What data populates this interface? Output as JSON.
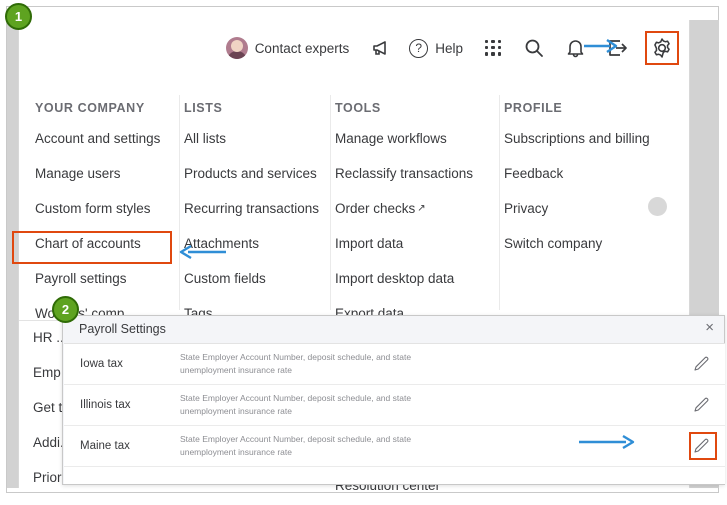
{
  "toolbar": {
    "contact_experts": "Contact experts",
    "megaphone_icon": "megaphone-icon",
    "help": "Help",
    "grid_icon": "app-grid-icon",
    "search_icon": "search-icon",
    "bell_icon": "notification-bell-icon",
    "exit_icon": "exit-icon",
    "gear_icon": "gear-icon"
  },
  "megamenu": {
    "columns": [
      {
        "header": "YOUR COMPANY",
        "items": [
          "Account and settings",
          "Manage users",
          "Custom form styles",
          "Chart of accounts",
          "Payroll settings",
          "Workers' comp"
        ]
      },
      {
        "header": "LISTS",
        "items": [
          "All lists",
          "Products and services",
          "Recurring transactions",
          "Attachments",
          "Custom fields",
          "Tags"
        ]
      },
      {
        "header": "TOOLS",
        "items": [
          "Manage workflows",
          "Reclassify transactions",
          "Order checks",
          "Import data",
          "Import desktop data",
          "Export data"
        ]
      },
      {
        "header": "PROFILE",
        "items": [
          "Subscriptions and billing",
          "Feedback",
          "Privacy",
          "Switch company"
        ]
      }
    ],
    "order_checks_external": "↗"
  },
  "background_list": {
    "items": [
      "HR ...",
      "Emp...",
      "Get t...",
      "Addi...",
      "Prior..."
    ],
    "bottom_center": "Resolution center"
  },
  "dialog": {
    "title": "Payroll Settings",
    "close_label": "×",
    "rows": [
      {
        "name": "Iowa tax",
        "description": "State Employer Account Number, deposit schedule, and state unemployment insurance rate",
        "edit_icon": "pencil-icon"
      },
      {
        "name": "Illinois tax",
        "description": "State Employer Account Number, deposit schedule, and state unemployment insurance rate",
        "edit_icon": "pencil-icon"
      },
      {
        "name": "Maine tax",
        "description": "State Employer Account Number, deposit schedule, and state unemployment insurance rate",
        "edit_icon": "pencil-icon"
      }
    ]
  },
  "annotations": {
    "badge_1": "1",
    "badge_2": "2",
    "highlight_color": "#e0480f",
    "arrow_color": "#2f8ed6",
    "badge_fill": "#5ea320",
    "badge_border": "#2f6b06"
  }
}
